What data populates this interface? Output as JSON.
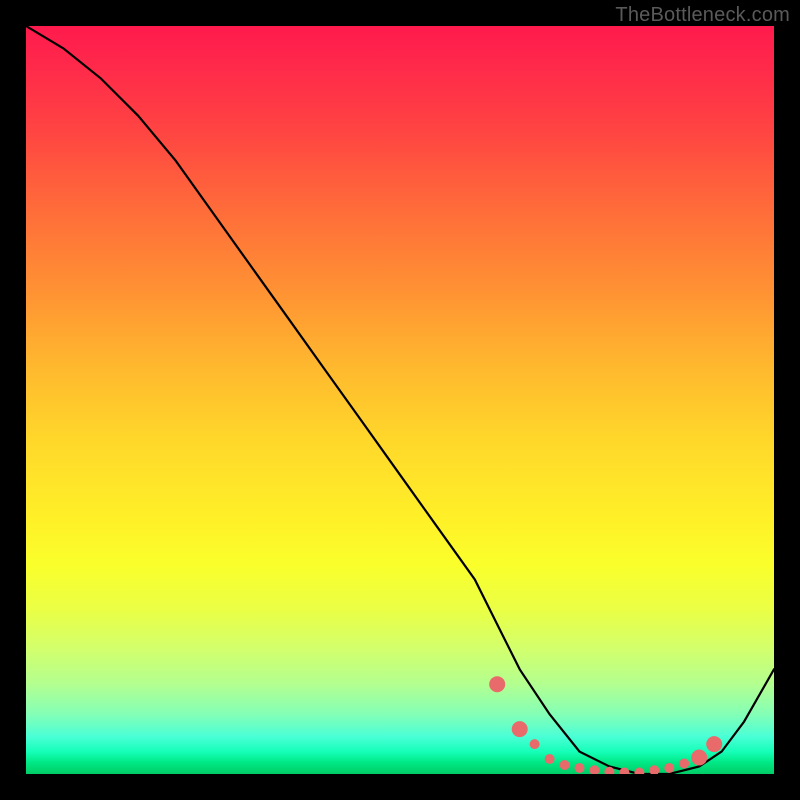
{
  "watermark": "TheBottleneck.com",
  "chart_data": {
    "type": "line",
    "title": "",
    "xlabel": "",
    "ylabel": "",
    "xlim": [
      0,
      100
    ],
    "ylim": [
      0,
      100
    ],
    "series": [
      {
        "name": "bottleneck-curve",
        "x": [
          0,
          5,
          10,
          15,
          20,
          25,
          30,
          35,
          40,
          45,
          50,
          55,
          60,
          63,
          66,
          70,
          74,
          78,
          82,
          86,
          90,
          93,
          96,
          100
        ],
        "y": [
          100,
          97,
          93,
          88,
          82,
          75,
          68,
          61,
          54,
          47,
          40,
          33,
          26,
          20,
          14,
          8,
          3,
          1,
          0,
          0,
          1,
          3,
          7,
          14
        ]
      }
    ],
    "markers": {
      "name": "highlight-dots",
      "x": [
        63,
        66,
        68,
        70,
        72,
        74,
        76,
        78,
        80,
        82,
        84,
        86,
        88,
        90,
        92
      ],
      "y": [
        12,
        6,
        4,
        2,
        1.2,
        0.8,
        0.5,
        0.3,
        0.2,
        0.2,
        0.5,
        0.8,
        1.4,
        2.2,
        4
      ],
      "color": "#e86a6a",
      "size_small": 5,
      "size_large": 8
    },
    "background_gradient": {
      "top": "#ff1a4d",
      "mid1": "#ffba2e",
      "mid2": "#faff2b",
      "bottom": "#00cc66"
    }
  }
}
